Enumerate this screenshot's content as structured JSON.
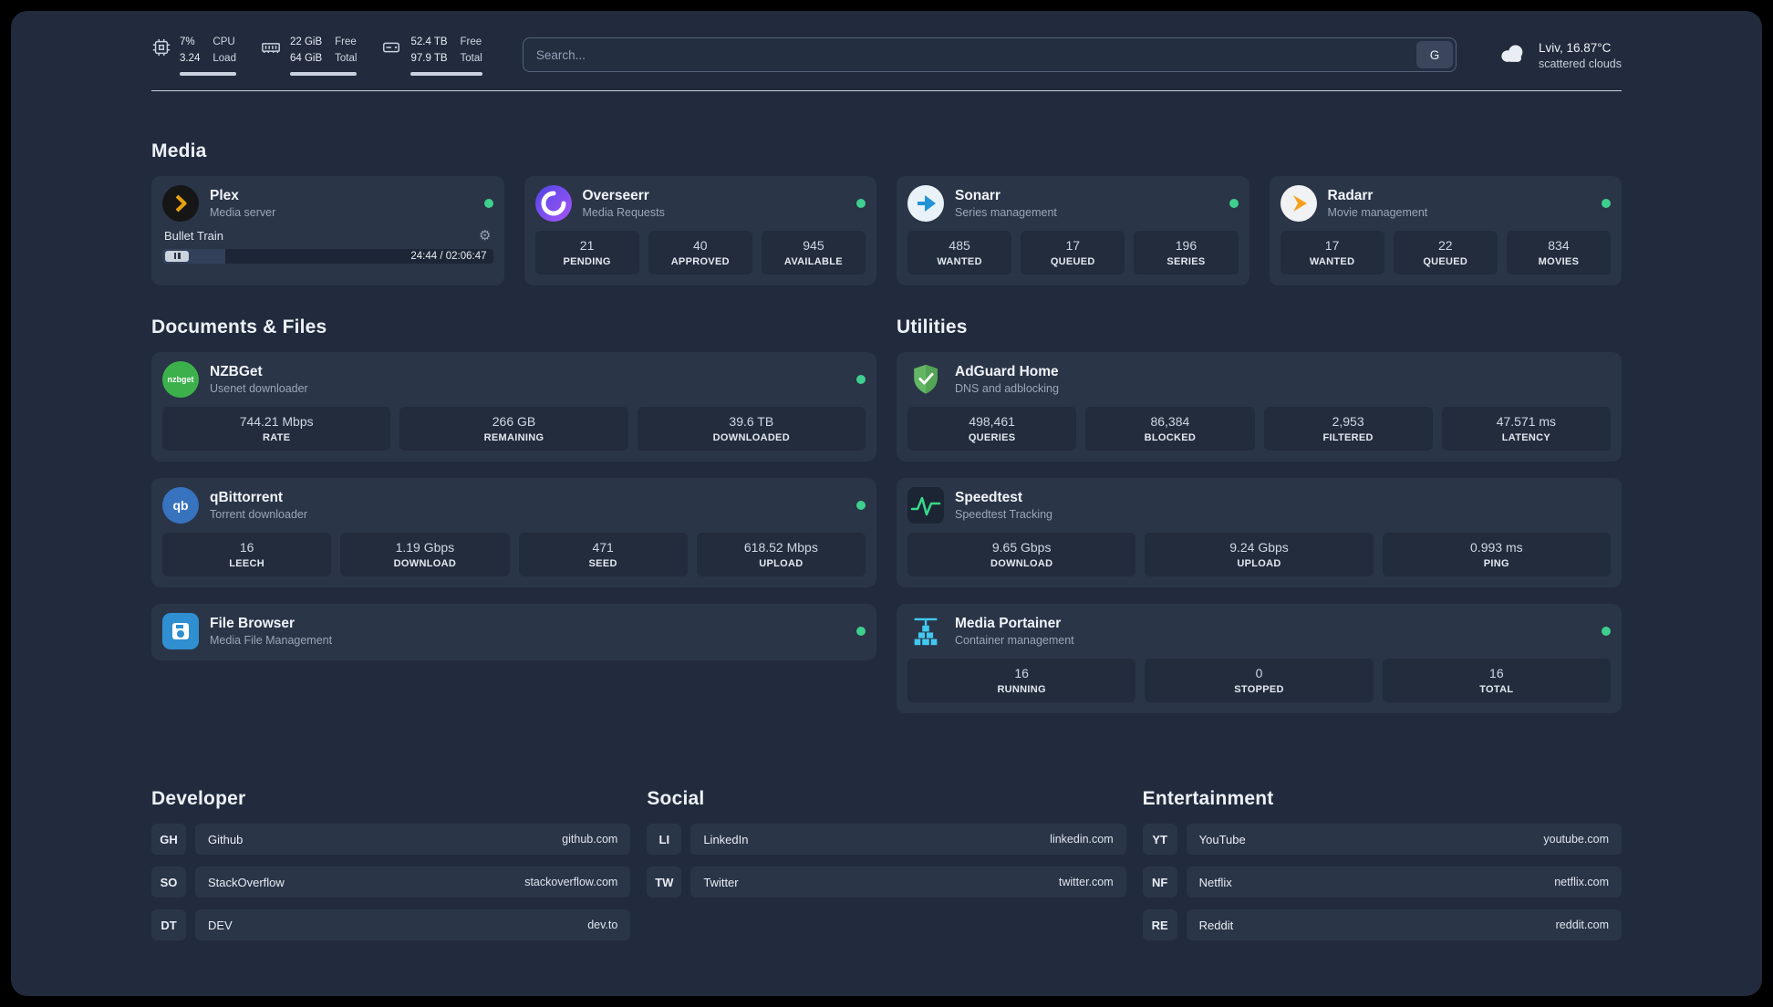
{
  "colors": {
    "status_online": "#3ecf8e",
    "plex_amber": "#e5a00d",
    "page_bg": "#212b3d",
    "card_bg": "#2a3548"
  },
  "topbar": {
    "cpu": {
      "value": "7%",
      "secondary": "3.24",
      "label_top": "CPU",
      "label_bottom": "Load"
    },
    "memory": {
      "value": "22 GiB",
      "secondary": "64 GiB",
      "label_top": "Free",
      "label_bottom": "Total"
    },
    "storage": {
      "value": "52.4 TB",
      "secondary": "97.9 TB",
      "label_top": "Free",
      "label_bottom": "Total"
    },
    "search": {
      "placeholder": "Search...",
      "engine_label": "G"
    },
    "weather": {
      "location": "Lviv, 16.87°C",
      "condition": "scattered clouds"
    }
  },
  "media": {
    "title": "Media",
    "plex": {
      "name": "Plex",
      "subtitle": "Media server",
      "now_playing": "Bullet Train",
      "time": "24:44 / 02:06:47",
      "progress_percent": 19
    },
    "overseerr": {
      "name": "Overseerr",
      "subtitle": "Media Requests",
      "stats": [
        {
          "value": "21",
          "label": "PENDING"
        },
        {
          "value": "40",
          "label": "APPROVED"
        },
        {
          "value": "945",
          "label": "AVAILABLE"
        }
      ]
    },
    "sonarr": {
      "name": "Sonarr",
      "subtitle": "Series management",
      "stats": [
        {
          "value": "485",
          "label": "WANTED"
        },
        {
          "value": "17",
          "label": "QUEUED"
        },
        {
          "value": "196",
          "label": "SERIES"
        }
      ]
    },
    "radarr": {
      "name": "Radarr",
      "subtitle": "Movie management",
      "stats": [
        {
          "value": "17",
          "label": "WANTED"
        },
        {
          "value": "22",
          "label": "QUEUED"
        },
        {
          "value": "834",
          "label": "MOVIES"
        }
      ]
    }
  },
  "documents": {
    "title": "Documents & Files",
    "nzbget": {
      "name": "NZBGet",
      "subtitle": "Usenet downloader",
      "icon_text": "nzbget",
      "stats": [
        {
          "value": "744.21 Mbps",
          "label": "RATE"
        },
        {
          "value": "266 GB",
          "label": "REMAINING"
        },
        {
          "value": "39.6 TB",
          "label": "DOWNLOADED"
        }
      ]
    },
    "qbittorrent": {
      "name": "qBittorrent",
      "subtitle": "Torrent downloader",
      "icon_text": "qb",
      "stats": [
        {
          "value": "16",
          "label": "LEECH"
        },
        {
          "value": "1.19 Gbps",
          "label": "DOWNLOAD"
        },
        {
          "value": "471",
          "label": "SEED"
        },
        {
          "value": "618.52 Mbps",
          "label": "UPLOAD"
        }
      ]
    },
    "filebrowser": {
      "name": "File Browser",
      "subtitle": "Media File Management"
    }
  },
  "utilities": {
    "title": "Utilities",
    "adguard": {
      "name": "AdGuard Home",
      "subtitle": "DNS and adblocking",
      "stats": [
        {
          "value": "498,461",
          "label": "QUERIES"
        },
        {
          "value": "86,384",
          "label": "BLOCKED"
        },
        {
          "value": "2,953",
          "label": "FILTERED"
        },
        {
          "value": "47.571 ms",
          "label": "LATENCY"
        }
      ]
    },
    "speedtest": {
      "name": "Speedtest",
      "subtitle": "Speedtest Tracking",
      "stats": [
        {
          "value": "9.65 Gbps",
          "label": "DOWNLOAD"
        },
        {
          "value": "9.24 Gbps",
          "label": "UPLOAD"
        },
        {
          "value": "0.993 ms",
          "label": "PING"
        }
      ]
    },
    "portainer": {
      "name": "Media Portainer",
      "subtitle": "Container management",
      "stats": [
        {
          "value": "16",
          "label": "RUNNING"
        },
        {
          "value": "0",
          "label": "STOPPED"
        },
        {
          "value": "16",
          "label": "TOTAL"
        }
      ]
    }
  },
  "bookmarks": {
    "developer": {
      "title": "Developer",
      "items": [
        {
          "abbr": "GH",
          "name": "Github",
          "domain": "github.com"
        },
        {
          "abbr": "SO",
          "name": "StackOverflow",
          "domain": "stackoverflow.com"
        },
        {
          "abbr": "DT",
          "name": "DEV",
          "domain": "dev.to"
        }
      ]
    },
    "social": {
      "title": "Social",
      "items": [
        {
          "abbr": "LI",
          "name": "LinkedIn",
          "domain": "linkedin.com"
        },
        {
          "abbr": "TW",
          "name": "Twitter",
          "domain": "twitter.com"
        }
      ]
    },
    "entertainment": {
      "title": "Entertainment",
      "items": [
        {
          "abbr": "YT",
          "name": "YouTube",
          "domain": "youtube.com"
        },
        {
          "abbr": "NF",
          "name": "Netflix",
          "domain": "netflix.com"
        },
        {
          "abbr": "RE",
          "name": "Reddit",
          "domain": "reddit.com"
        }
      ]
    }
  }
}
